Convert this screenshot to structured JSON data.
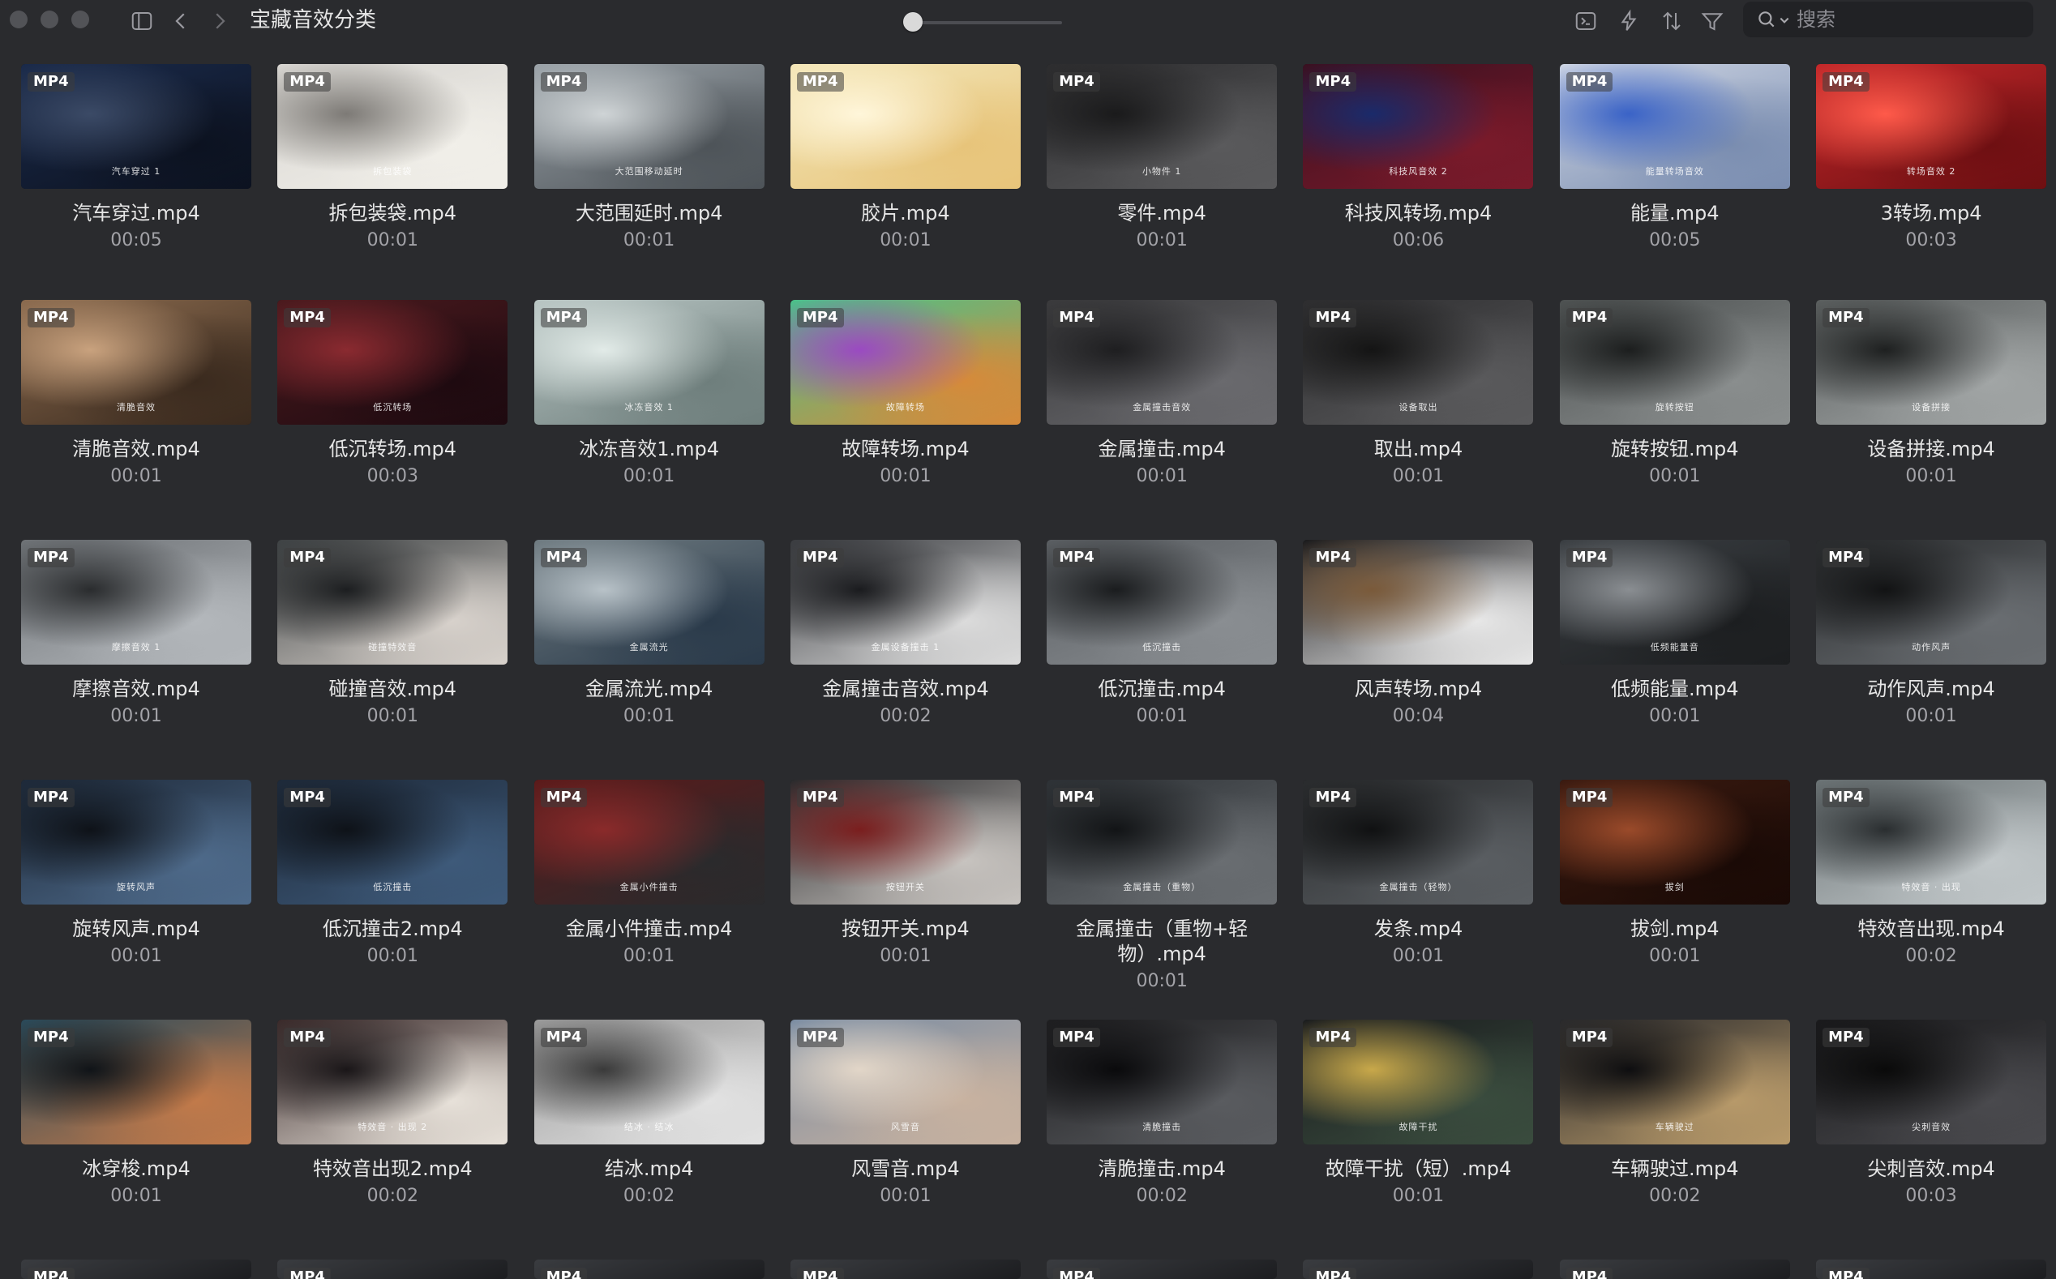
{
  "window": {
    "title": "宝藏音效分类"
  },
  "toolbar": {
    "icons": [
      "sidebar-toggle-icon",
      "back-chevron-icon",
      "forward-chevron-icon",
      "terminal-icon",
      "bolt-icon",
      "sort-icon",
      "filter-icon"
    ],
    "zoom_level": 0.0
  },
  "search": {
    "placeholder": "搜索"
  },
  "badge_label": "MP4",
  "items": [
    {
      "name": "汽车穿过.mp4",
      "duration": "00:05",
      "caption": "汽车穿过 1",
      "tint": [
        "#1a2a4a",
        "#0c1220",
        "#3b4a66"
      ]
    },
    {
      "name": "拆包装袋.mp4",
      "duration": "00:01",
      "caption": "拆包装袋",
      "tint": [
        "#d8d6d2",
        "#f1efe9",
        "#7d7a76"
      ]
    },
    {
      "name": "大范围延时.mp4",
      "duration": "00:01",
      "caption": "大范围移动延时",
      "tint": [
        "#9aa2a8",
        "#4d5358",
        "#cfd4d6"
      ]
    },
    {
      "name": "胶片.mp4",
      "duration": "00:01",
      "caption": "",
      "tint": [
        "#f3e6b8",
        "#e7c47a",
        "#fff6da"
      ]
    },
    {
      "name": "零件.mp4",
      "duration": "00:01",
      "caption": "小物件 1",
      "tint": [
        "#2d2d2f",
        "#5a5a5c",
        "#1a1a1b"
      ]
    },
    {
      "name": "科技风转场.mp4",
      "duration": "00:06",
      "caption": "科技风音效 2",
      "tint": [
        "#3a1020",
        "#7a1a2a",
        "#1a2a6a"
      ]
    },
    {
      "name": "能量.mp4",
      "duration": "00:05",
      "caption": "能量转场音效",
      "tint": [
        "#cfd6e4",
        "#7a8db0",
        "#3a63c7"
      ]
    },
    {
      "name": "3转场.mp4",
      "duration": "00:03",
      "caption": "转场音效 2",
      "tint": [
        "#c3282a",
        "#6e0f12",
        "#ff5a4a"
      ]
    },
    {
      "name": "清脆音效.mp4",
      "duration": "00:01",
      "caption": "清脆音效",
      "tint": [
        "#8a6a4e",
        "#3a2a1e",
        "#c9a27e"
      ]
    },
    {
      "name": "低沉转场.mp4",
      "duration": "00:03",
      "caption": "低沉转场",
      "tint": [
        "#4a1a1e",
        "#1e0a10",
        "#8a2a30"
      ]
    },
    {
      "name": "冰冻音效1.mp4",
      "duration": "00:01",
      "caption": "冰冻音效 1",
      "tint": [
        "#b7c4c2",
        "#6e7e7c",
        "#e2ebe8"
      ]
    },
    {
      "name": "故障转场.mp4",
      "duration": "00:01",
      "caption": "故障转场",
      "tint": [
        "#49c28a",
        "#d68a3a",
        "#9a4ac2"
      ]
    },
    {
      "name": "金属撞击.mp4",
      "duration": "00:01",
      "caption": "金属撞击音效",
      "tint": [
        "#3a3a3c",
        "#6a6a6e",
        "#1e1e20"
      ]
    },
    {
      "name": "取出.mp4",
      "duration": "00:01",
      "caption": "设备取出",
      "tint": [
        "#2e2e30",
        "#5a5a5c",
        "#141414"
      ]
    },
    {
      "name": "旋转按钮.mp4",
      "duration": "00:01",
      "caption": "旋转按钮",
      "tint": [
        "#4e5252",
        "#8a8e8e",
        "#1c1e1e"
      ]
    },
    {
      "name": "设备拼接.mp4",
      "duration": "00:01",
      "caption": "设备拼接",
      "tint": [
        "#5a5e5e",
        "#a2a6a6",
        "#1e2020"
      ]
    },
    {
      "name": "摩擦音效.mp4",
      "duration": "00:01",
      "caption": "摩擦音效 1",
      "tint": [
        "#6e7276",
        "#b4b8bc",
        "#2a2c2e"
      ]
    },
    {
      "name": "碰撞音效.mp4",
      "duration": "00:01",
      "caption": "碰撞特效音",
      "tint": [
        "#3e4244",
        "#d8d2cc",
        "#1c1e20"
      ]
    },
    {
      "name": "金属流光.mp4",
      "duration": "00:01",
      "caption": "金属流光",
      "tint": [
        "#6e7a80",
        "#2a3a4a",
        "#b8c2c8"
      ]
    },
    {
      "name": "金属撞击音效.mp4",
      "duration": "00:02",
      "caption": "金属设备撞击 1",
      "tint": [
        "#3a3c40",
        "#dcdcdc",
        "#1a1b1e"
      ]
    },
    {
      "name": "低沉撞击.mp4",
      "duration": "00:01",
      "caption": "低沉撞击",
      "tint": [
        "#5a5e62",
        "#8a8e92",
        "#1a1c1e"
      ]
    },
    {
      "name": "风声转场.mp4",
      "duration": "00:04",
      "caption": "",
      "tint": [
        "#1a1a1c",
        "#e8e8e8",
        "#7a5a3a"
      ]
    },
    {
      "name": "低频能量.mp4",
      "duration": "00:01",
      "caption": "低频能量音",
      "tint": [
        "#3a3e42",
        "#1c1e20",
        "#8a8e92"
      ]
    },
    {
      "name": "动作风声.mp4",
      "duration": "00:01",
      "caption": "动作风声",
      "tint": [
        "#2a2c2e",
        "#6a6e72",
        "#121314"
      ]
    },
    {
      "name": "旋转风声.mp4",
      "duration": "00:01",
      "caption": "旋转风声",
      "tint": [
        "#1e2a3a",
        "#4e6a8a",
        "#0e1218"
      ]
    },
    {
      "name": "低沉撞击2.mp4",
      "duration": "00:01",
      "caption": "低沉撞击",
      "tint": [
        "#1e2a3a",
        "#3e5a7a",
        "#0e1218"
      ]
    },
    {
      "name": "金属小件撞击.mp4",
      "duration": "00:01",
      "caption": "金属小件撞击",
      "tint": [
        "#5a1a1a",
        "#2a2a2c",
        "#8a2a2a"
      ]
    },
    {
      "name": "按钮开关.mp4",
      "duration": "00:01",
      "caption": "按钮开关",
      "tint": [
        "#2a2a2c",
        "#c8c4c0",
        "#7a1e1e"
      ]
    },
    {
      "name": "金属撞击（重物+轻物）.mp4",
      "duration": "00:01",
      "caption": "金属撞击（重物）",
      "tint": [
        "#2e3236",
        "#6a6e72",
        "#121416"
      ]
    },
    {
      "name": "发条.mp4",
      "duration": "00:01",
      "caption": "金属撞击（轻物）",
      "tint": [
        "#2a2c2e",
        "#5a5e62",
        "#101112"
      ]
    },
    {
      "name": "拔剑.mp4",
      "duration": "00:01",
      "caption": "拔剑",
      "tint": [
        "#3a1a10",
        "#1a0a06",
        "#9a4a2a"
      ]
    },
    {
      "name": "特效音出现.mp4",
      "duration": "00:02",
      "caption": "特效音 · 出现",
      "tint": [
        "#6a7274",
        "#c2c8ca",
        "#2a2e30"
      ]
    },
    {
      "name": "冰穿梭.mp4",
      "duration": "00:01",
      "caption": "",
      "tint": [
        "#2a4a5a",
        "#c27a4a",
        "#101418"
      ]
    },
    {
      "name": "特效音出现2.mp4",
      "duration": "00:02",
      "caption": "特效音 · 出现 2",
      "tint": [
        "#3a2a2a",
        "#e8e2da",
        "#1a1618"
      ]
    },
    {
      "name": "结冰.mp4",
      "duration": "00:02",
      "caption": "结冰 · 结冰",
      "tint": [
        "#9a9a9a",
        "#e2e2e2",
        "#3a3a3a"
      ]
    },
    {
      "name": "风雪音.mp4",
      "duration": "00:01",
      "caption": "风雪音",
      "tint": [
        "#7a8ca2",
        "#c8b2a0",
        "#e2d6c8"
      ]
    },
    {
      "name": "清脆撞击.mp4",
      "duration": "00:02",
      "caption": "清脆撞击",
      "tint": [
        "#1e1e20",
        "#5a5c60",
        "#0a0a0c"
      ]
    },
    {
      "name": "故障干扰（短）.mp4",
      "duration": "00:01",
      "caption": "故障干扰",
      "tint": [
        "#1a1c1e",
        "#3a4c3e",
        "#c8a84a"
      ]
    },
    {
      "name": "车辆驶过.mp4",
      "duration": "00:02",
      "caption": "车辆驶过",
      "tint": [
        "#2a2a2c",
        "#b89a6a",
        "#0e0e10"
      ]
    },
    {
      "name": "尖刺音效.mp4",
      "duration": "00:03",
      "caption": "尖刺音效",
      "tint": [
        "#1a1a1c",
        "#4a4a4e",
        "#0a0a0a"
      ]
    }
  ],
  "partial_row_count": 8
}
